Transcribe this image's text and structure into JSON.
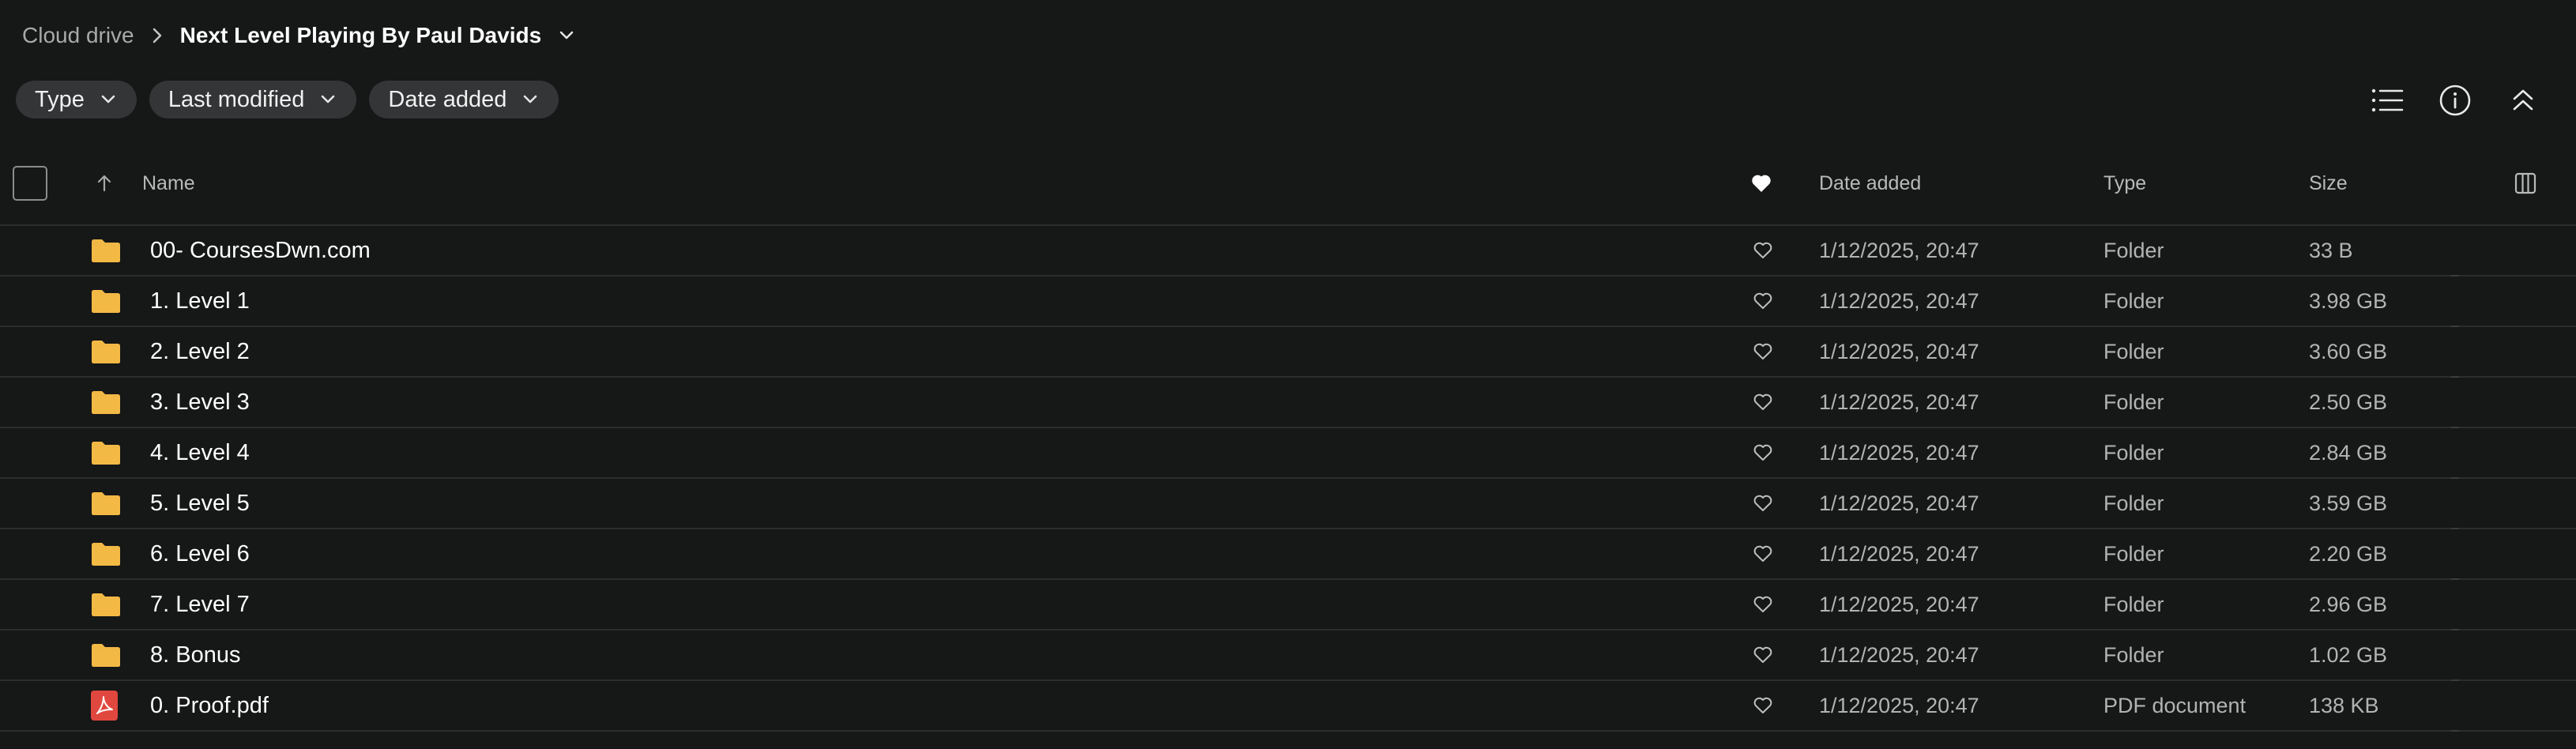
{
  "breadcrumb": {
    "root": "Cloud drive",
    "current": "Next Level Playing By Paul Davids"
  },
  "filters": [
    {
      "label": "Type"
    },
    {
      "label": "Last modified"
    },
    {
      "label": "Date added"
    }
  ],
  "toolbar_icons": [
    "list-view-icon",
    "info-icon",
    "collapse-icon"
  ],
  "table": {
    "columns": {
      "name": "Name",
      "date_added": "Date added",
      "type": "Type",
      "size": "Size"
    },
    "sort": {
      "column": "name",
      "direction": "ascending"
    },
    "rows": [
      {
        "icon": "folder-icon",
        "name": "00- CoursesDwn.com",
        "date": "1/12/2025, 20:47",
        "type": "Folder",
        "size": "33 B"
      },
      {
        "icon": "folder-icon",
        "name": "1. Level 1",
        "date": "1/12/2025, 20:47",
        "type": "Folder",
        "size": "3.98 GB"
      },
      {
        "icon": "folder-icon",
        "name": "2. Level 2",
        "date": "1/12/2025, 20:47",
        "type": "Folder",
        "size": "3.60 GB"
      },
      {
        "icon": "folder-icon",
        "name": "3. Level 3",
        "date": "1/12/2025, 20:47",
        "type": "Folder",
        "size": "2.50 GB"
      },
      {
        "icon": "folder-icon",
        "name": "4. Level 4",
        "date": "1/12/2025, 20:47",
        "type": "Folder",
        "size": "2.84 GB"
      },
      {
        "icon": "folder-icon",
        "name": "5. Level 5",
        "date": "1/12/2025, 20:47",
        "type": "Folder",
        "size": "3.59 GB"
      },
      {
        "icon": "folder-icon",
        "name": "6. Level 6",
        "date": "1/12/2025, 20:47",
        "type": "Folder",
        "size": "2.20 GB"
      },
      {
        "icon": "folder-icon",
        "name": "7. Level 7",
        "date": "1/12/2025, 20:47",
        "type": "Folder",
        "size": "2.96 GB"
      },
      {
        "icon": "folder-icon",
        "name": "8. Bonus",
        "date": "1/12/2025, 20:47",
        "type": "Folder",
        "size": "1.02 GB"
      },
      {
        "icon": "pdf-icon",
        "name": "0. Proof.pdf",
        "date": "1/12/2025, 20:47",
        "type": "PDF document",
        "size": "138 KB"
      }
    ]
  },
  "colors": {
    "background": "#161717",
    "chip": "#333536",
    "folder": "#f2b845",
    "pdf": "#e0473f",
    "divider": "#2b2d2e"
  }
}
